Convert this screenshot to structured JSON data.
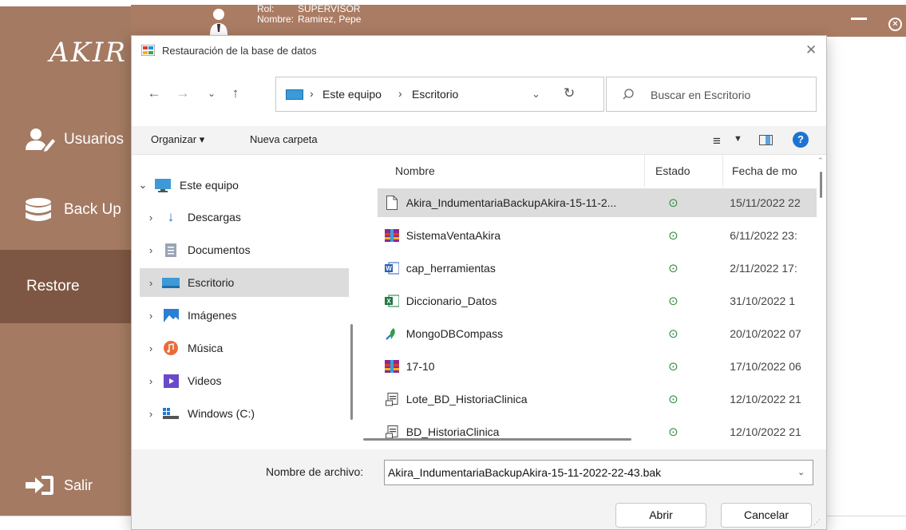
{
  "app": {
    "logo": "AKIR",
    "rol_label": "Rol:",
    "rol_value": "SUPERVISOR",
    "nombre_label": "Nombre:",
    "nombre_value": "Ramirez, Pepe"
  },
  "sidebar": {
    "items": [
      {
        "label": "Usuarios",
        "icon": "users-icon"
      },
      {
        "label": "Back Up",
        "icon": "database-icon"
      },
      {
        "label": "Restore",
        "icon": ""
      },
      {
        "label": "Salir",
        "icon": "exit-icon"
      }
    ]
  },
  "dialog": {
    "title": "Restauración de la base de datos",
    "address": {
      "seg1": "Este equipo",
      "seg2": "Escritorio"
    },
    "search_placeholder": "Buscar en Escritorio",
    "toolbar": {
      "organizar": "Organizar ▾",
      "nueva_carpeta": "Nueva carpeta"
    },
    "tree": [
      {
        "label": "Este equipo",
        "icon": "computer-icon",
        "expanded": true
      },
      {
        "label": "Descargas",
        "icon": "download-icon"
      },
      {
        "label": "Documentos",
        "icon": "documents-icon"
      },
      {
        "label": "Escritorio",
        "icon": "desktop-icon",
        "selected": true
      },
      {
        "label": "Imágenes",
        "icon": "pictures-icon"
      },
      {
        "label": "Música",
        "icon": "music-icon"
      },
      {
        "label": "Videos",
        "icon": "videos-icon"
      },
      {
        "label": "Windows (C:)",
        "icon": "drive-icon"
      }
    ],
    "columns": {
      "nombre": "Nombre",
      "estado": "Estado",
      "fecha": "Fecha de mo"
    },
    "files": [
      {
        "name": "Akira_IndumentariaBackupAkira-15-11-2...",
        "state": "⊙",
        "date": "15/11/2022 22",
        "icon": "blank-file-icon",
        "selected": true
      },
      {
        "name": "SistemaVentaAkira",
        "state": "⊙",
        "date": "6/11/2022 23:",
        "icon": "winrar-icon"
      },
      {
        "name": "cap_herramientas",
        "state": "⊙",
        "date": "2/11/2022 17:",
        "icon": "word-icon"
      },
      {
        "name": "Diccionario_Datos",
        "state": "⊙",
        "date": "31/10/2022 1",
        "icon": "excel-icon"
      },
      {
        "name": "MongoDBCompass",
        "state": "⊙",
        "date": "20/10/2022 07",
        "icon": "shortcut-icon"
      },
      {
        "name": "17-10",
        "state": "⊙",
        "date": "17/10/2022 06",
        "icon": "winrar-icon"
      },
      {
        "name": "Lote_BD_HistoriaClinica",
        "state": "⊙",
        "date": "12/10/2022 21",
        "icon": "script-icon"
      },
      {
        "name": "BD_HistoriaClinica",
        "state": "⊙",
        "date": "12/10/2022 21",
        "icon": "script-icon"
      }
    ],
    "filename_label": "Nombre de archivo:",
    "filename_value": "Akira_IndumentariaBackupAkira-15-11-2022-22-43.bak",
    "btn_open": "Abrir",
    "btn_cancel": "Cancelar"
  }
}
